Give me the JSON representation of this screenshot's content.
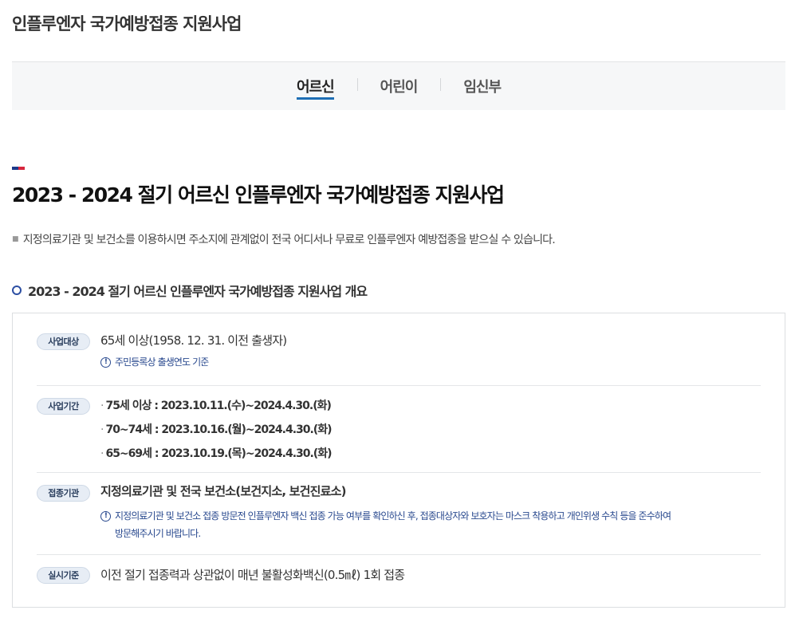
{
  "page": {
    "title": "인플루엔자 국가예방접종 지원사업"
  },
  "tabs": [
    {
      "label": "어르신",
      "active": true
    },
    {
      "label": "어린이",
      "active": false
    },
    {
      "label": "임신부",
      "active": false
    }
  ],
  "section": {
    "heading": "2023 - 2024 절기 어르신 인플루엔자 국가예방접종 지원사업",
    "intro": "지정의료기관 및 보건소를 이용하시면 주소지에 관계없이 전국 어디서나 무료로 인플루엔자 예방접종을 받으실 수 있습니다."
  },
  "overview": {
    "heading": "2023 - 2024 절기 어르신 인플루엔자 국가예방접종 지원사업 개요",
    "target": {
      "badge": "사업대상",
      "text": "65세 이상(1958. 12. 31. 이전 출생자)",
      "note": "주민등록상 출생연도 기준"
    },
    "period": {
      "badge": "사업기간",
      "items": [
        "75세 이상 : 2023.10.11.(수)~2024.4.30.(화)",
        "70~74세 : 2023.10.16.(월)~2024.4.30.(화)",
        "65~69세 : 2023.10.19.(목)~2024.4.30.(화)"
      ]
    },
    "institution": {
      "badge": "접종기관",
      "text": "지정의료기관 및 전국 보건소(보건지소, 보건진료소)",
      "note_line1": "지정의료기관 및 보건소 접종 방문전 인플루엔자 백신 접종 가능 여부를 확인하신 후, 접종대상자와 보호자는 마스크 착용하고 개인위생 수칙 등을 준수하여",
      "note_line2": "방문해주시기 바랍니다."
    },
    "standard": {
      "badge": "실시기준",
      "text": "이전 절기 접종력과 상관없이 매년 불활성화백신(0.5㎖) 1회 접종"
    }
  },
  "colors": {
    "accent_blue": "#1f6fb5",
    "note_blue": "#2a4a8f",
    "accent_navy": "#1d3a8a",
    "accent_red": "#d7263d"
  }
}
